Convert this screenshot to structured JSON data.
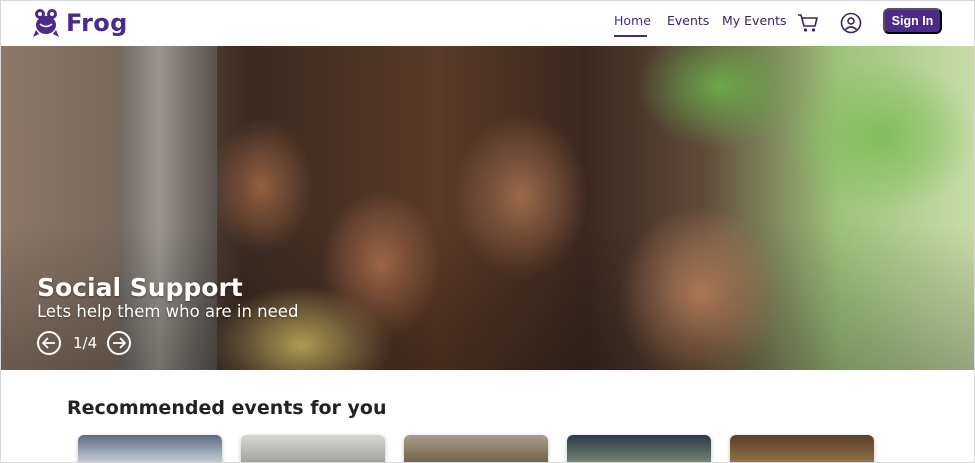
{
  "brand": {
    "name": "Frog",
    "logo_icon": "frog-icon",
    "color": "#4b2a8a"
  },
  "nav": {
    "links": [
      {
        "label": "Home",
        "active": true
      },
      {
        "label": "Events",
        "active": false
      },
      {
        "label": "My Events",
        "active": false
      }
    ],
    "cart_icon": "cart-icon",
    "account_icon": "user-circle-icon",
    "signin_label": "Sign In"
  },
  "hero": {
    "title": "Social Support",
    "subtitle": "Lets help them who are in need",
    "counter": "1/4",
    "prev_icon": "arrow-left-circle-icon",
    "next_icon": "arrow-right-circle-icon"
  },
  "recommended": {
    "title": "Recommended events for you",
    "cards": [
      {
        "name": "event-card-1"
      },
      {
        "name": "event-card-2"
      },
      {
        "name": "event-card-3"
      },
      {
        "name": "event-card-4"
      },
      {
        "name": "event-card-5"
      }
    ]
  }
}
